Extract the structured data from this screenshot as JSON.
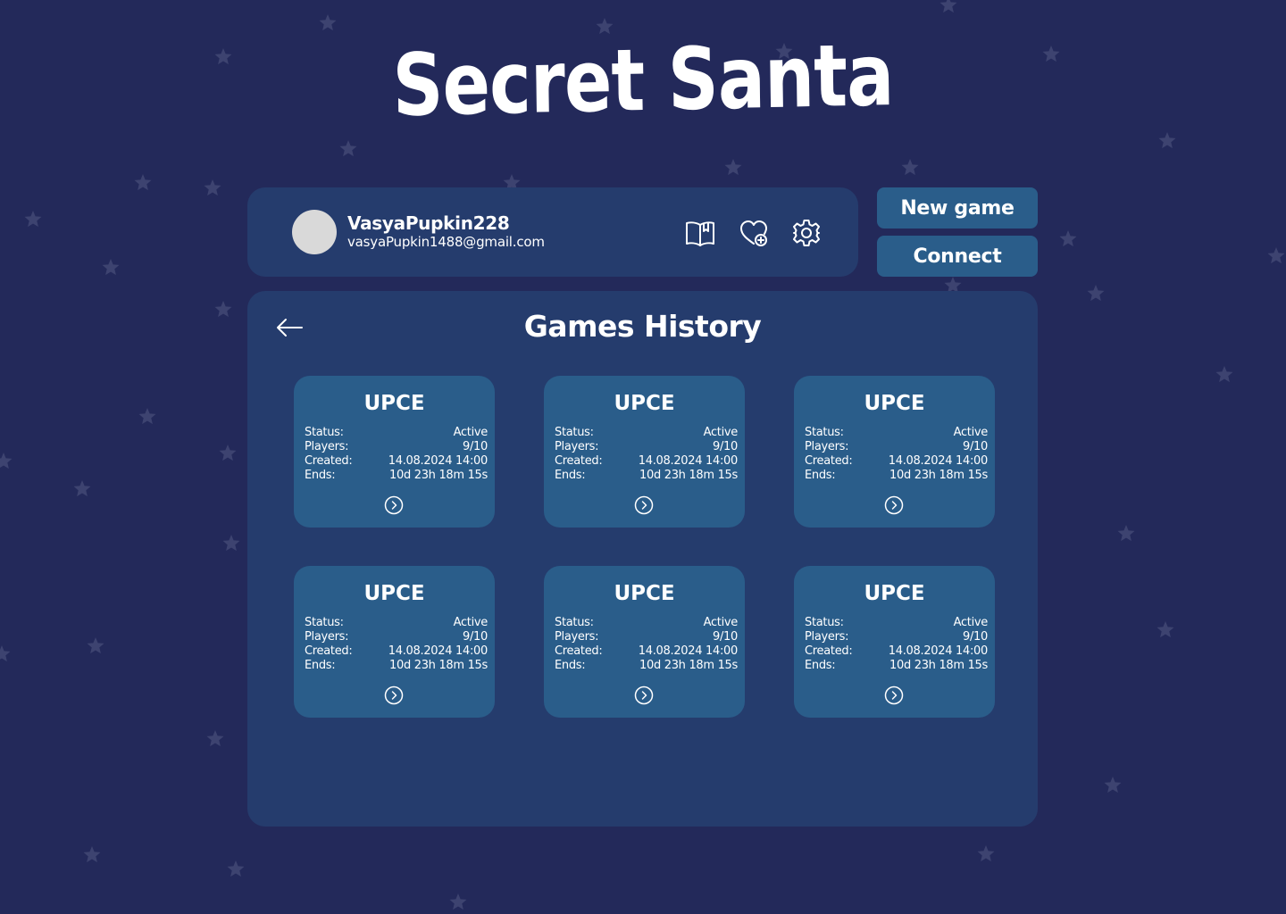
{
  "app": {
    "title": "Secret Santa"
  },
  "colors": {
    "background": "#23295a",
    "panel": "#253c6d",
    "card": "#2a5d8a",
    "star": "#3d4370",
    "avatar": "#d9d9d9"
  },
  "user": {
    "name": "VasyaPupkin228",
    "email": "vasyaPupkin1488@gmail.com"
  },
  "toolbar": {
    "icons": [
      "book-icon",
      "heart-plus-icon",
      "gear-icon"
    ]
  },
  "actions": {
    "new_game": "New game",
    "connect": "Connect"
  },
  "history": {
    "title": "Games History",
    "labels": {
      "status": "Status:",
      "players": "Players:",
      "created": "Created:",
      "ends": "Ends:"
    },
    "games": [
      {
        "name": "UPCE",
        "status": "Active",
        "players": "9/10",
        "created": "14.08.2024 14:00",
        "ends": "10d 23h 18m 15s"
      },
      {
        "name": "UPCE",
        "status": "Active",
        "players": "9/10",
        "created": "14.08.2024 14:00",
        "ends": "10d 23h 18m 15s"
      },
      {
        "name": "UPCE",
        "status": "Active",
        "players": "9/10",
        "created": "14.08.2024 14:00",
        "ends": "10d 23h 18m 15s"
      },
      {
        "name": "UPCE",
        "status": "Active",
        "players": "9/10",
        "created": "14.08.2024 14:00",
        "ends": "10d 23h 18m 15s"
      },
      {
        "name": "UPCE",
        "status": "Active",
        "players": "9/10",
        "created": "14.08.2024 14:00",
        "ends": "10d 23h 18m 15s"
      },
      {
        "name": "UPCE",
        "status": "Active",
        "players": "9/10",
        "created": "14.08.2024 14:00",
        "ends": "10d 23h 18m 15s"
      }
    ]
  }
}
